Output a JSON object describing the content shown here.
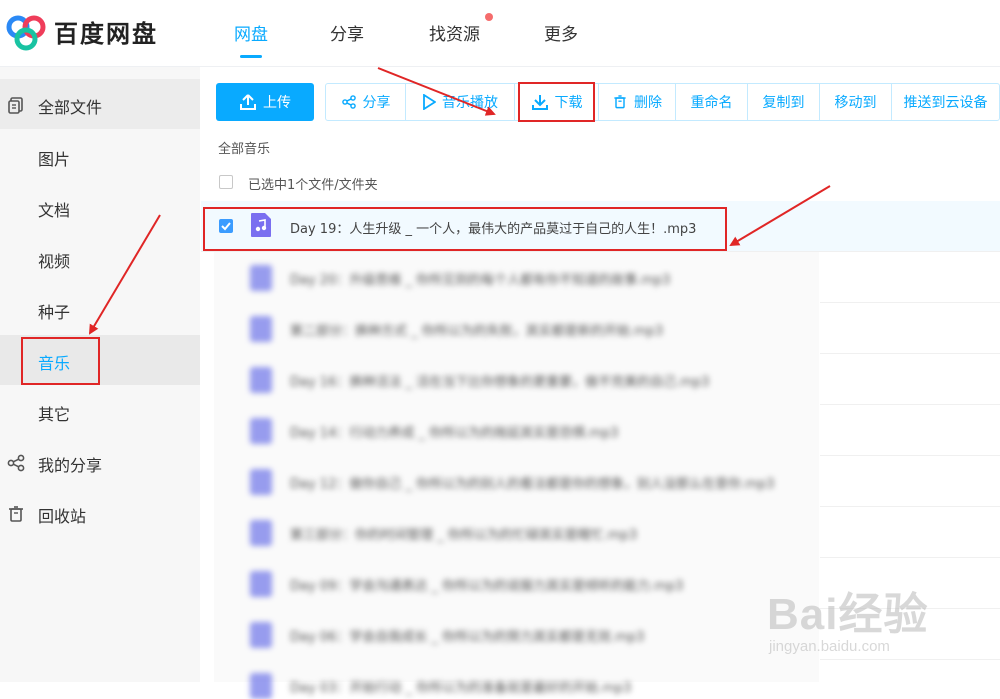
{
  "header": {
    "brand": "百度网盘",
    "tabs": [
      {
        "label": "网盘"
      },
      {
        "label": "分享"
      },
      {
        "label": "找资源"
      },
      {
        "label": "更多"
      }
    ]
  },
  "sidebar": {
    "items": [
      {
        "label": "全部文件",
        "icon": "file-icon"
      },
      {
        "label": "图片"
      },
      {
        "label": "文档"
      },
      {
        "label": "视频"
      },
      {
        "label": "种子"
      },
      {
        "label": "音乐"
      },
      {
        "label": "其它"
      },
      {
        "label": "我的分享",
        "icon": "share-icon"
      },
      {
        "label": "回收站",
        "icon": "trash-icon"
      }
    ]
  },
  "toolbar": {
    "upload": "上传",
    "share": "分享",
    "play_music": "音乐播放",
    "download": "下载",
    "delete": "删除",
    "rename": "重命名",
    "copy_to": "复制到",
    "move_to": "移动到",
    "push_to_device": "推送到云设备"
  },
  "breadcrumb": "全部音乐",
  "selection_status": "已选中1个文件/文件夹",
  "files": [
    {
      "name": "Day 19：人生升级 _ 一个人，最伟大的产品莫过于自己的人生！.mp3",
      "selected": true
    },
    {
      "name": "Day 20：升级思维 _ 你所见到的每个人都有你不知道的故事.mp3",
      "selected": false
    },
    {
      "name": "第二部分：换种方式 _ 你所以为的失败，其实都是新的开始.mp3",
      "selected": false
    },
    {
      "name": "Day 16：换种活法 _ 活在当下比你想象的更重要，做不完美的自己.mp3",
      "selected": false
    },
    {
      "name": "Day 14：行动力养成 _ 你所以为的拖延其实是恐惧.mp3",
      "selected": false
    },
    {
      "name": "Day 12：做你自己 _ 你所以为的别人的看法都是你的想象，别人没那么在意你.mp3",
      "selected": false
    },
    {
      "name": "第三部分：你的时间管理 _ 你所以为的忙碌其实是瞎忙.mp3",
      "selected": false
    },
    {
      "name": "Day 09：学会沟通表达 _ 你所以为的说服力其实是倾听的能力.mp3",
      "selected": false
    },
    {
      "name": "Day 06：学会自我成长 _ 你所以为的努力其实都是无效.mp3",
      "selected": false
    },
    {
      "name": "Day 03：开始行动 _ 你所以为的准备就是最好的开始.mp3",
      "selected": false
    }
  ],
  "watermark": {
    "text": "Bai经验",
    "url": "jingyan.baidu.com"
  },
  "colors": {
    "accent": "#09aaff",
    "annotation": "#e02626"
  }
}
